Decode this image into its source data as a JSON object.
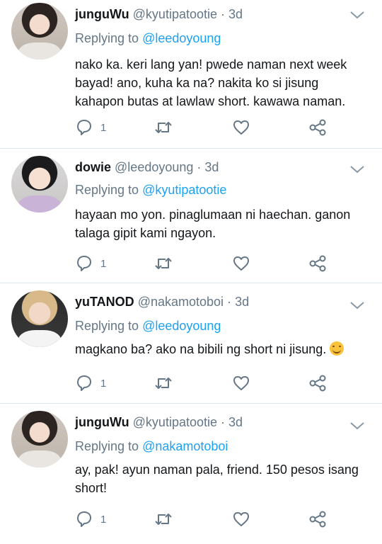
{
  "tweets": [
    {
      "name": "junguWu",
      "handle": "@kyutipatootie",
      "time": "3d",
      "reply_prefix": "Replying to",
      "reply_user": "@leedoyoung",
      "text_lines": [
        "nako ka. keri lang yan! pwede naman next week",
        "bayad! ano, kuha ka na? nakita ko si jisung",
        "kahapon butas at lawlaw short. kawawa naman."
      ],
      "reply_count": "1"
    },
    {
      "name": "dowie",
      "handle": "@leedoyoung",
      "time": "3d",
      "reply_prefix": "Replying to",
      "reply_user": "@kyutipatootie",
      "text_lines": [
        "hayaan mo yon. pinaglumaan ni haechan. ganon",
        "talaga gipit kami ngayon."
      ],
      "reply_count": "1"
    },
    {
      "name": "yuTANOD",
      "handle": "@nakamotoboi",
      "time": "3d",
      "reply_prefix": "Replying to",
      "reply_user": "@leedoyoung",
      "text_lines": [
        "magkano ba? ako na bibili ng short ni jisung."
      ],
      "reply_count": "1",
      "emoji": "smiling-face-icon"
    },
    {
      "name": "junguWu",
      "handle": "@kyutipatootie",
      "time": "3d",
      "reply_prefix": "Replying to",
      "reply_user": "@nakamotoboi",
      "text_lines": [
        "ay, pak! ayun naman pala, friend. 150 pesos isang",
        "short!"
      ],
      "reply_count": "1"
    }
  ],
  "separator": "·",
  "colors": {
    "link": "#1da1f2",
    "muted": "#657786",
    "text": "#14171a"
  }
}
